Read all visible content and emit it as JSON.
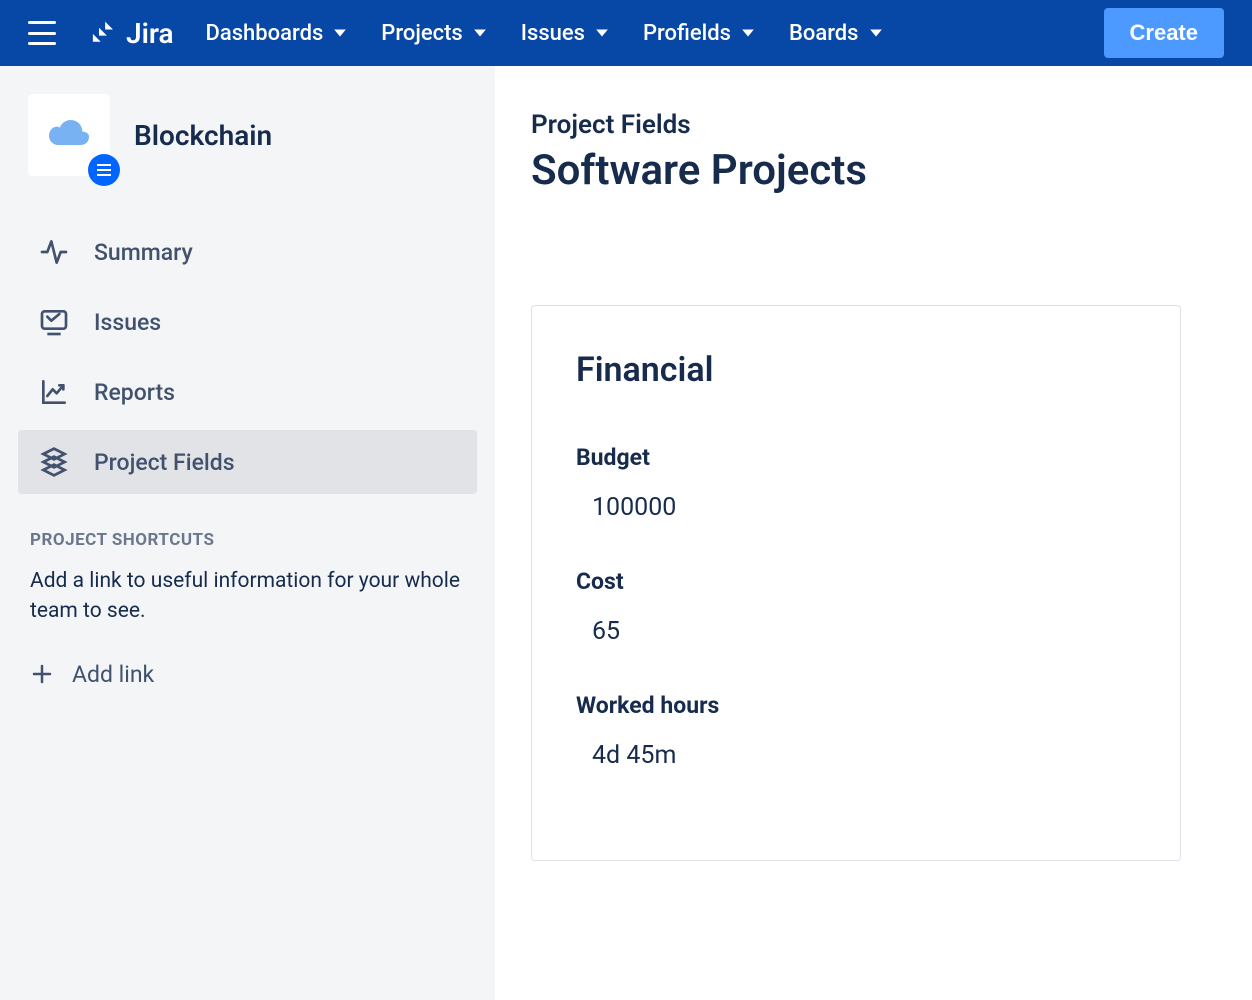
{
  "nav": {
    "items": [
      "Dashboards",
      "Projects",
      "Issues",
      "Profields",
      "Boards"
    ],
    "create_label": "Create"
  },
  "project": {
    "name": "Blockchain"
  },
  "sidebar": {
    "items": [
      {
        "label": "Summary"
      },
      {
        "label": "Issues"
      },
      {
        "label": "Reports"
      },
      {
        "label": "Project Fields"
      }
    ],
    "shortcuts_heading": "PROJECT SHORTCUTS",
    "shortcuts_text": "Add a link to useful information for your whole team to see.",
    "add_link_label": "Add link"
  },
  "page": {
    "label": "Project Fields",
    "title": "Software Projects"
  },
  "panel": {
    "title": "Financial",
    "fields": [
      {
        "label": "Budget",
        "value": "100000"
      },
      {
        "label": "Cost",
        "value": "65"
      },
      {
        "label": "Worked hours",
        "value": "4d 45m"
      }
    ]
  }
}
